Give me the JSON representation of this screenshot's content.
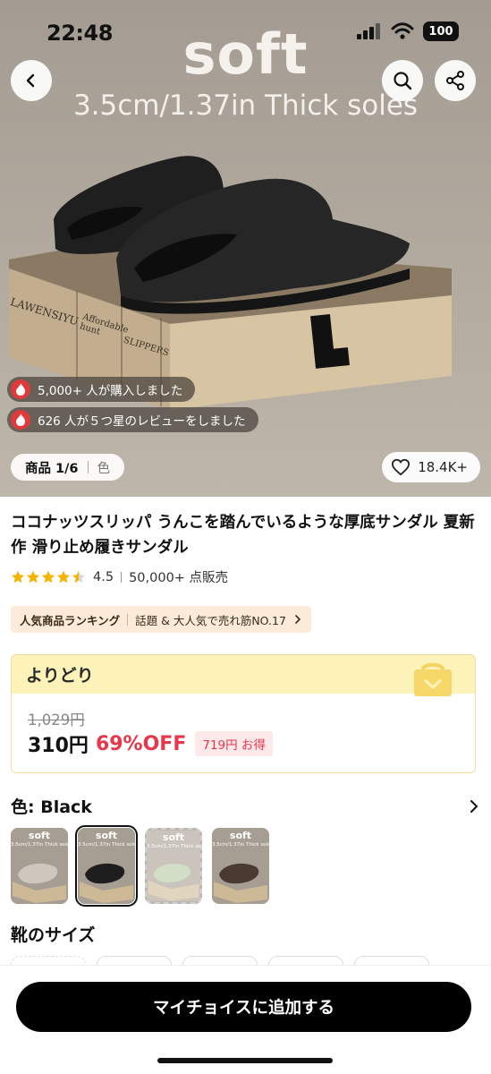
{
  "status": {
    "time": "22:48",
    "battery": "100"
  },
  "hero": {
    "title": "soft",
    "subtitle": "3.5cm/1.37in Thick soles",
    "box_text": {
      "brand": "LAWENSIYU",
      "tag": "Affordable hunt",
      "type": "SLIPPERS",
      "side_brand": "LAIWENSIYU",
      "logo": "L"
    }
  },
  "social": {
    "purchased": "5,000+ 人が購入しました",
    "reviews": "626 人が５つ星のレビューをしました"
  },
  "image_counter": {
    "index": "商品 1/6",
    "tab": "色"
  },
  "likes": "18.4K+",
  "product": {
    "title": "ココナッツスリッパ うんこを踏んでいるような厚底サンダル 夏新作 滑り止め履きサンダル",
    "rating": "4.5",
    "rating_value": 4.5,
    "sold": "50,000+ 点販売"
  },
  "ranking": {
    "label": "人気商品ランキング",
    "text": "話題 & 大人気で売れ筋NO.17"
  },
  "deal": {
    "title": "よりどり",
    "old_price": "1,029円",
    "price": "310円",
    "discount": "69%OFF",
    "savings": "719円 お得"
  },
  "color": {
    "label": "色: Black"
  },
  "thumbnails": [
    {
      "title": "soft",
      "sub": "3.5cm/1.37in Thick soles",
      "color": "#cfc7bd"
    },
    {
      "title": "soft",
      "sub": "3.5cm/1.37in Thick soles",
      "color": "#1e1e1e"
    },
    {
      "title": "soft",
      "sub": "3.5cm/1.37in Thick soles",
      "color": "#c8d6b9"
    },
    {
      "title": "soft",
      "sub": "3.5cm/1.37in Thick soles",
      "color": "#4a3a30"
    }
  ],
  "size": {
    "label": "靴のサイズ"
  },
  "cta": "マイチョイスに追加する",
  "colors": {
    "accent_red": "#e8364a",
    "deal_yellow": "#fdf3b9",
    "rank_bg": "#fbebd8"
  }
}
